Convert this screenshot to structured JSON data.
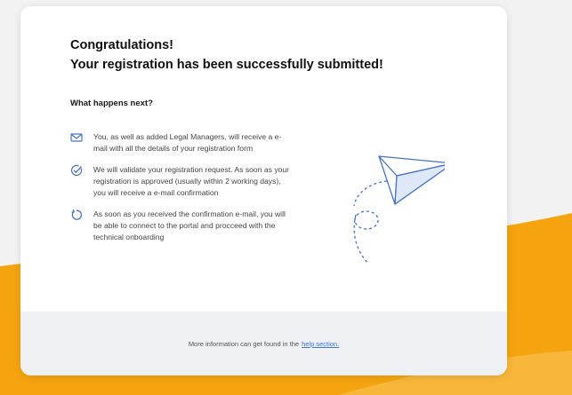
{
  "colors": {
    "accent": "#4a72c8",
    "orange": "#f5a410",
    "link": "#3d74d6",
    "footer_bg": "#eef0f4"
  },
  "header": {
    "title_line1": "Congratulations!",
    "title_line2": "Your registration has been successfully submitted!"
  },
  "next": {
    "heading": "What happens next?",
    "steps": [
      {
        "icon": "envelope-icon",
        "text": "You, as well as added Legal Managers, will receive a e-mail with all the details of your registration form"
      },
      {
        "icon": "check-circle-icon",
        "text": "We will validate your registration request. As soon as your registration is approved (usually within 2 working days), you will receive a e-mail confirmation"
      },
      {
        "icon": "refresh-icon",
        "text": "As soon as you received the confirmation e-mail, you will be able to connect to the portal and procceed with the technical onboarding"
      }
    ]
  },
  "illustration": {
    "icon": "paper-plane-icon"
  },
  "footer": {
    "text": "More information can get found in the",
    "link_label": "help section."
  }
}
